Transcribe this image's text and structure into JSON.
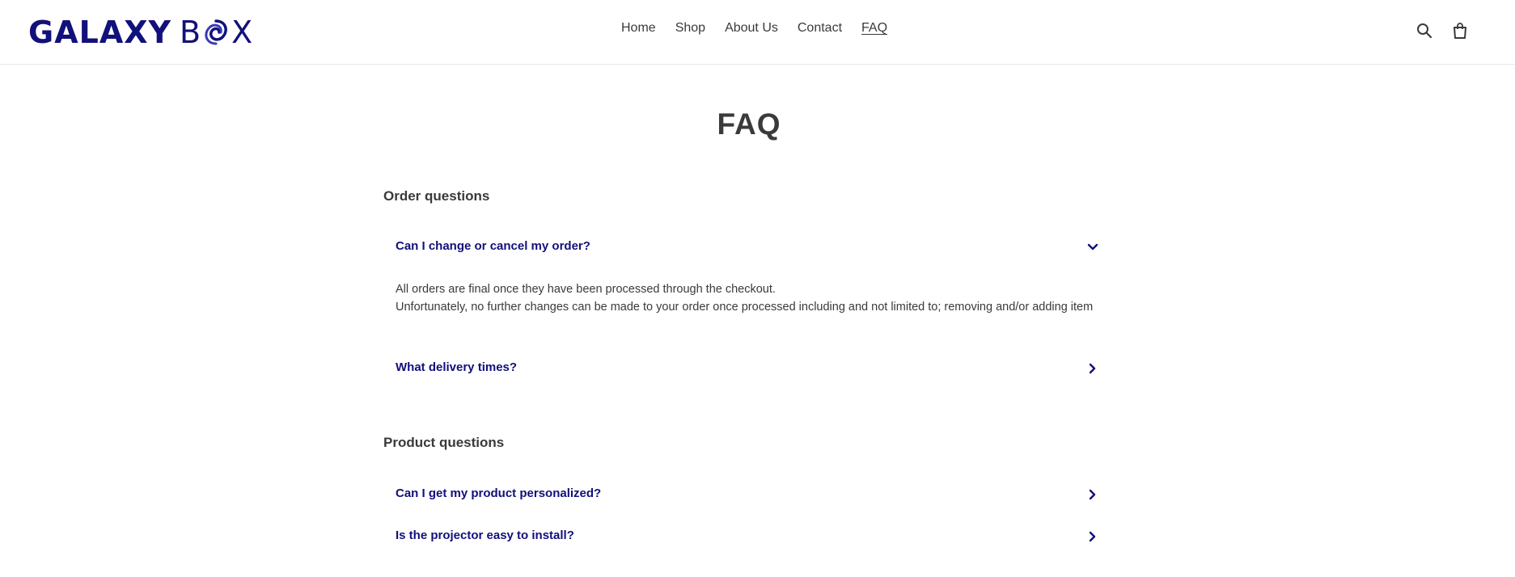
{
  "brand": {
    "part1": "GALAXY",
    "part2_start": "B",
    "part2_end": "X",
    "color": "#12107a"
  },
  "nav": {
    "items": [
      {
        "label": "Home"
      },
      {
        "label": "Shop"
      },
      {
        "label": "About Us"
      },
      {
        "label": "Contact"
      },
      {
        "label": "FAQ",
        "active": true
      }
    ]
  },
  "header_icons": [
    "search-icon",
    "cart-icon"
  ],
  "page": {
    "title": "FAQ"
  },
  "sections": [
    {
      "title": "Order questions",
      "questions": [
        {
          "question": "Can I change or cancel my order?",
          "expanded": true,
          "answer_lines": [
            "All orders are final once they have been processed through the checkout.",
            "Unfortunately, no further changes can be made to your order once processed including and not limited to; removing and/or adding item"
          ]
        },
        {
          "question": "What delivery times?",
          "expanded": false
        }
      ]
    },
    {
      "title": "Product questions",
      "questions": [
        {
          "question": "Can I get my product personalized?",
          "expanded": false
        },
        {
          "question": "Is the projector easy to install?",
          "expanded": false
        }
      ]
    }
  ]
}
